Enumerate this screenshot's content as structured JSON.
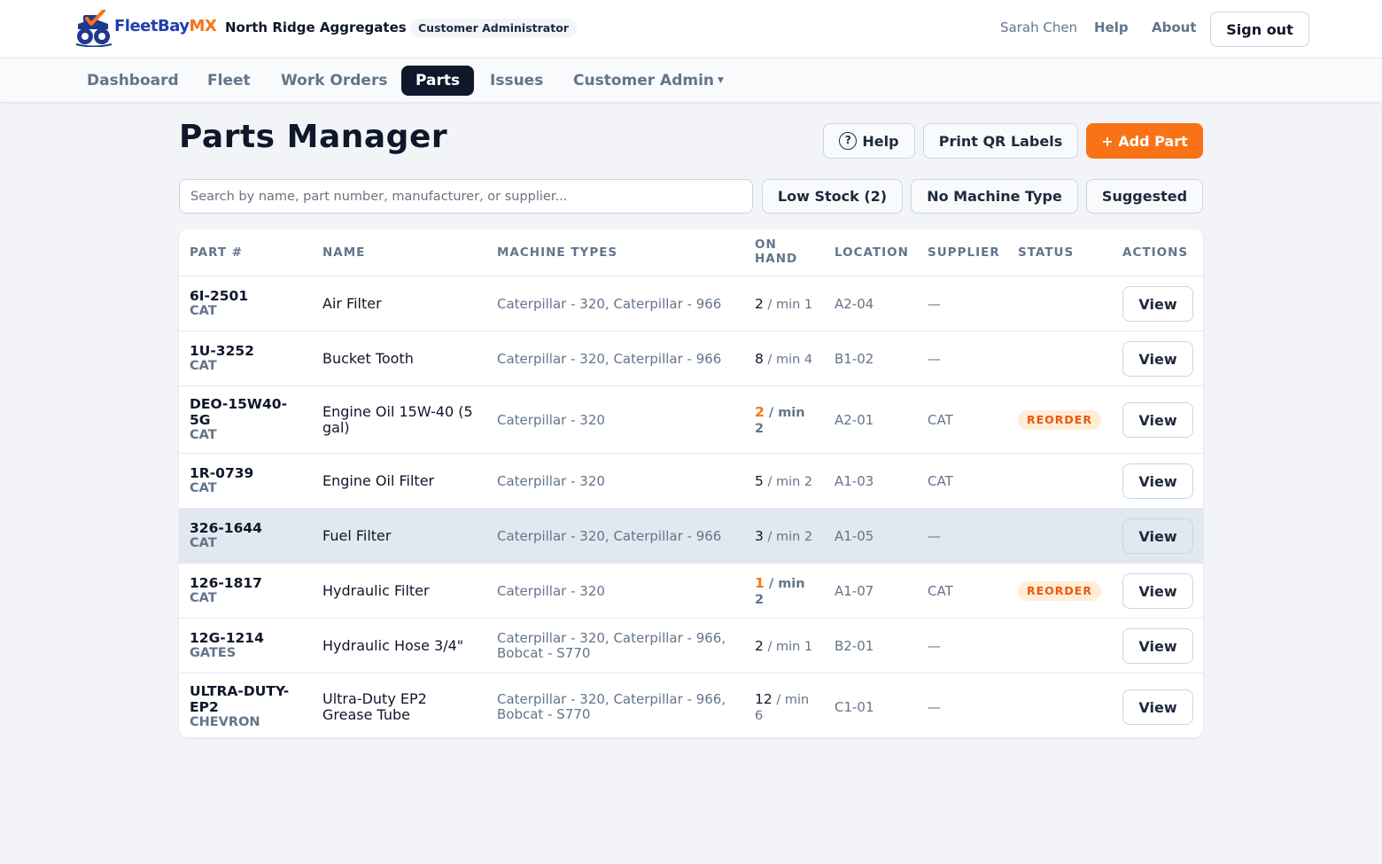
{
  "header": {
    "brand_part1": "FleetBay",
    "brand_part2": "MX",
    "org_name": "North Ridge Aggregates",
    "role": "Customer Administrator",
    "user_name": "Sarah Chen",
    "help_label": "Help",
    "about_label": "About",
    "signout_label": "Sign out"
  },
  "nav": {
    "items": [
      {
        "label": "Dashboard"
      },
      {
        "label": "Fleet"
      },
      {
        "label": "Work Orders"
      },
      {
        "label": "Parts",
        "active": true
      },
      {
        "label": "Issues"
      },
      {
        "label": "Customer Admin",
        "dropdown": true
      }
    ]
  },
  "page": {
    "title": "Parts Manager",
    "help_label": "Help",
    "print_label": "Print QR Labels",
    "add_label": "+ Add Part",
    "search_placeholder": "Search by name, part number, manufacturer, or supplier...",
    "filters": [
      "Low Stock (2)",
      "No Machine Type",
      "Suggested"
    ]
  },
  "table": {
    "columns": [
      "PART #",
      "NAME",
      "MACHINE TYPES",
      "ON HAND",
      "LOCATION",
      "SUPPLIER",
      "STATUS",
      "ACTIONS"
    ],
    "rows": [
      {
        "part_lines": [
          "6I-2501"
        ],
        "mfr": "CAT",
        "name_lines": [
          "Air Filter"
        ],
        "types_lines": [
          "Caterpillar - 320, Caterpillar - 966"
        ],
        "qty": "2",
        "min_lines": [
          " / min 1"
        ],
        "low": false,
        "location": "A2-04",
        "supplier": "—",
        "status": "",
        "action": "View"
      },
      {
        "part_lines": [
          "1U-3252"
        ],
        "mfr": "CAT",
        "name_lines": [
          "Bucket Tooth"
        ],
        "types_lines": [
          "Caterpillar - 320, Caterpillar - 966"
        ],
        "qty": "8",
        "min_lines": [
          " / min 4"
        ],
        "low": false,
        "location": "B1-02",
        "supplier": "—",
        "status": "",
        "action": "View"
      },
      {
        "part_lines": [
          "DEO-15W40-",
          "5G"
        ],
        "mfr": "CAT",
        "name_lines": [
          "Engine Oil 15W-40 (5",
          "gal)"
        ],
        "types_lines": [
          "Caterpillar - 320"
        ],
        "qty": "2",
        "min_lines": [
          " / min",
          "2"
        ],
        "low": true,
        "location": "A2-01",
        "supplier": "CAT",
        "status": "REORDER",
        "action": "View"
      },
      {
        "part_lines": [
          "1R-0739"
        ],
        "mfr": "CAT",
        "name_lines": [
          "Engine Oil Filter"
        ],
        "types_lines": [
          "Caterpillar - 320"
        ],
        "qty": "5",
        "min_lines": [
          " / min 2"
        ],
        "low": false,
        "location": "A1-03",
        "supplier": "CAT",
        "status": "",
        "action": "View"
      },
      {
        "part_lines": [
          "326-1644"
        ],
        "mfr": "CAT",
        "name_lines": [
          "Fuel Filter"
        ],
        "types_lines": [
          "Caterpillar - 320, Caterpillar - 966"
        ],
        "qty": "3",
        "min_lines": [
          " / min 2"
        ],
        "low": false,
        "location": "A1-05",
        "supplier": "—",
        "status": "",
        "action": "View",
        "highlighted": true
      },
      {
        "part_lines": [
          "126-1817"
        ],
        "mfr": "CAT",
        "name_lines": [
          "Hydraulic Filter"
        ],
        "types_lines": [
          "Caterpillar - 320"
        ],
        "qty": "1",
        "min_lines": [
          " / min",
          "2"
        ],
        "low": true,
        "location": "A1-07",
        "supplier": "CAT",
        "status": "REORDER",
        "action": "View"
      },
      {
        "part_lines": [
          "12G-1214"
        ],
        "mfr": "GATES",
        "name_lines": [
          "Hydraulic Hose 3/4\""
        ],
        "types_lines": [
          "Caterpillar - 320, Caterpillar - 966,",
          "Bobcat - S770"
        ],
        "qty": "2",
        "min_lines": [
          " / min 1"
        ],
        "low": false,
        "location": "B2-01",
        "supplier": "—",
        "status": "",
        "action": "View"
      },
      {
        "part_lines": [
          "ULTRA-DUTY-",
          "EP2"
        ],
        "mfr": "CHEVRON",
        "name_lines": [
          "Ultra-Duty EP2",
          "Grease Tube"
        ],
        "types_lines": [
          "Caterpillar - 320, Caterpillar - 966,",
          "Bobcat - S770"
        ],
        "qty": "12",
        "min_lines": [
          " / min",
          "6"
        ],
        "low": false,
        "location": "C1-01",
        "supplier": "—",
        "status": "",
        "action": "View"
      }
    ]
  },
  "colors": {
    "accent": "#f97316",
    "nav_active": "#0f172a",
    "brand_blue": "#1e40af",
    "reorder_bg": "#ffedd5",
    "reorder_text": "#ea580c"
  }
}
